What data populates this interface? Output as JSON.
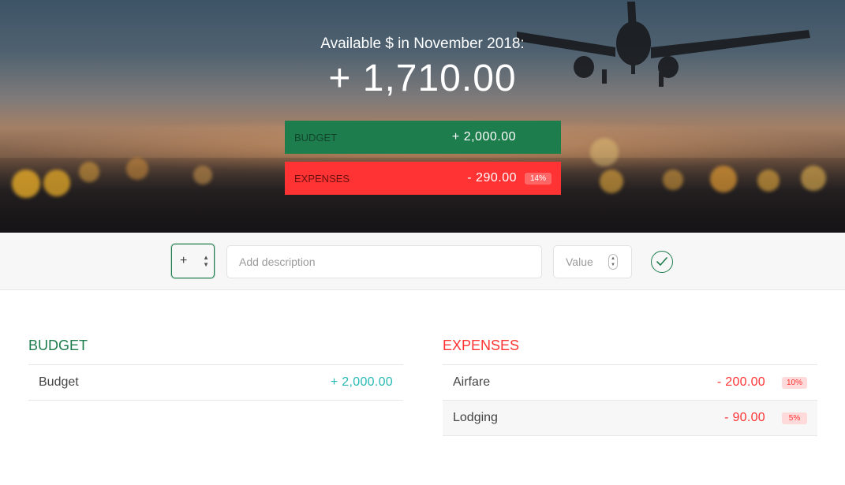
{
  "header": {
    "title": "Available $ in November 2018:",
    "available_amount": "+ 1,710.00",
    "budget": {
      "label": "Budget",
      "value": "+ 2,000.00"
    },
    "expenses": {
      "label": "Expenses",
      "value": "- 290.00",
      "percentage": "14%"
    }
  },
  "add_form": {
    "type_value": "+",
    "description_placeholder": "Add description",
    "value_placeholder": "Value",
    "submit_icon": "check-circle-icon"
  },
  "budget_list": {
    "title": "Budget",
    "items": [
      {
        "description": "Budget",
        "value": "+ 2,000.00"
      }
    ]
  },
  "expenses_list": {
    "title": "Expenses",
    "items": [
      {
        "description": "Airfare",
        "value": "- 200.00",
        "percentage": "10%"
      },
      {
        "description": "Lodging",
        "value": "- 90.00",
        "percentage": "5%"
      }
    ]
  },
  "colors": {
    "income_green": "#1e7d4d",
    "income_value": "#28b9b5",
    "expense_red": "#ff3333"
  }
}
